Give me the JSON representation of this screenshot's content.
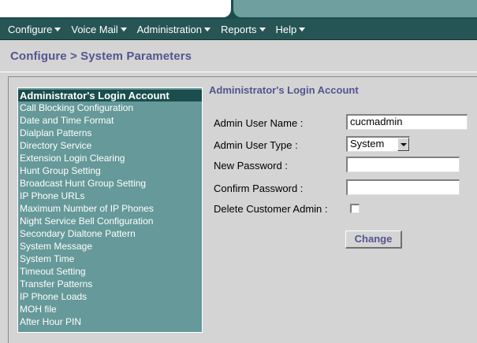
{
  "menu": [
    {
      "label": "Configure"
    },
    {
      "label": "Voice Mail"
    },
    {
      "label": "Administration"
    },
    {
      "label": "Reports"
    },
    {
      "label": "Help"
    }
  ],
  "page_title": "Configure > System Parameters",
  "sidebar": {
    "items": [
      {
        "label": "Administrator's Login Account",
        "active": true
      },
      {
        "label": "Call Blocking Configuration"
      },
      {
        "label": "Date and Time Format"
      },
      {
        "label": "Dialplan Patterns"
      },
      {
        "label": "Directory Service"
      },
      {
        "label": "Extension Login Clearing"
      },
      {
        "label": "Hunt Group Setting"
      },
      {
        "label": "Broadcast Hunt Group Setting"
      },
      {
        "label": "IP Phone URLs"
      },
      {
        "label": "Maximum Number of IP Phones"
      },
      {
        "label": "Night Service Bell Configuration"
      },
      {
        "label": "Secondary Dialtone Pattern"
      },
      {
        "label": "System Message"
      },
      {
        "label": "System Time"
      },
      {
        "label": "Timeout Setting"
      },
      {
        "label": "Transfer Patterns"
      },
      {
        "label": "IP Phone Loads"
      },
      {
        "label": "MOH file"
      },
      {
        "label": "After Hour PIN"
      }
    ]
  },
  "form": {
    "section_title": "Administrator's Login Account",
    "admin_user_name": {
      "label": "Admin User Name  :",
      "value": "cucmadmin"
    },
    "admin_user_type": {
      "label": "Admin User Type  :",
      "value": "System"
    },
    "new_password": {
      "label": "New Password  :",
      "value": ""
    },
    "confirm_password": {
      "label": "Confirm Password  :",
      "value": ""
    },
    "delete_customer_admin": {
      "label": "Delete Customer Admin  :",
      "checked": false
    },
    "change_button": "Change"
  },
  "colors": {
    "header_dark": "#1b4d4d",
    "menu_bar": "#275555",
    "sidebar_bg": "#669999",
    "title_text": "#545491",
    "page_bg": "#d4d4d4"
  }
}
